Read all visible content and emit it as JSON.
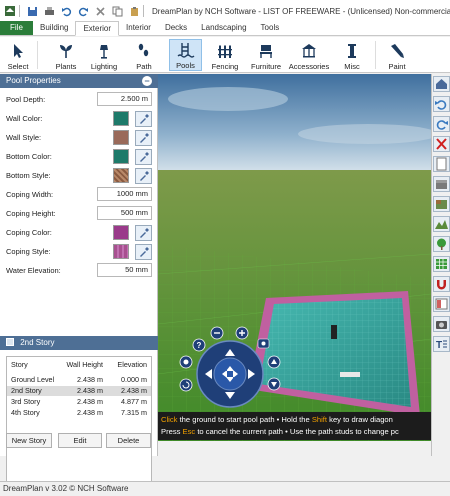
{
  "window": {
    "title": "DreamPlan by NCH Software - LIST OF FREEWARE - (Unlicensed) Non-commercial home ..."
  },
  "ribbon_tabs": [
    "File",
    "Building",
    "Exterior",
    "Interior",
    "Decks",
    "Landscaping",
    "Tools"
  ],
  "active_tab": "Exterior",
  "ribbon_buttons": [
    {
      "label": "Select",
      "icon": "cursor-icon"
    },
    {
      "label": "Plants",
      "icon": "plant-icon"
    },
    {
      "label": "Lighting",
      "icon": "lamp-icon"
    },
    {
      "label": "Path",
      "icon": "footprints-icon"
    },
    {
      "label": "Pools",
      "icon": "pool-icon"
    },
    {
      "label": "Fencing",
      "icon": "fence-icon"
    },
    {
      "label": "Furniture",
      "icon": "chair-icon"
    },
    {
      "label": "Accessories",
      "icon": "gazebo-icon"
    },
    {
      "label": "Misc",
      "icon": "pillar-icon"
    },
    {
      "label": "Paint",
      "icon": "paint-icon"
    }
  ],
  "pool_properties": {
    "title": "Pool Properties",
    "pool_depth": {
      "label": "Pool Depth:",
      "value": "2.500 m"
    },
    "wall_color": {
      "label": "Wall Color:",
      "color": "#1e7a6a"
    },
    "wall_style": {
      "label": "Wall Style:",
      "color": "#9a6a5a"
    },
    "bottom_color": {
      "label": "Bottom Color:",
      "color": "#1e7a6a"
    },
    "bottom_style": {
      "label": "Bottom Style:",
      "color": "#b88868"
    },
    "coping_width": {
      "label": "Coping Width:",
      "value": "1000 mm"
    },
    "coping_height": {
      "label": "Coping Height:",
      "value": "500 mm"
    },
    "coping_color": {
      "label": "Coping Color:",
      "color": "#9a3a8a"
    },
    "coping_style": {
      "label": "Coping Style:",
      "color": "#a85090"
    },
    "water_elevation": {
      "label": "Water Elevation:",
      "value": "50 mm"
    }
  },
  "story_panel": {
    "title": "2nd Story",
    "columns": [
      "Story",
      "Wall Height",
      "Elevation"
    ],
    "rows": [
      {
        "story": "Ground Level",
        "wall_height": "2.438 m",
        "elevation": "0.000 m"
      },
      {
        "story": "2nd Story",
        "wall_height": "2.438 m",
        "elevation": "2.438 m"
      },
      {
        "story": "3rd Story",
        "wall_height": "2.438 m",
        "elevation": "4.877 m"
      },
      {
        "story": "4th Story",
        "wall_height": "2.438 m",
        "elevation": "7.315 m"
      }
    ],
    "buttons": [
      "New Story",
      "Edit",
      "Delete"
    ]
  },
  "hint": {
    "line1": [
      "Click",
      " the ground to start pool path • Hold the ",
      "Shift",
      " key to draw diagon"
    ],
    "line2": [
      "Press ",
      "Esc",
      " to cancel the current path • Use the path studs to change pc"
    ]
  },
  "status": "DreamPlan v 3.02 © NCH Software",
  "colors": {
    "panel_header": "#4e6f95",
    "file_tab": "#2b7d3a",
    "hint_key": "#f0a000",
    "pool_coping": "#c060a0",
    "pool_water": "#3aa8a0"
  }
}
